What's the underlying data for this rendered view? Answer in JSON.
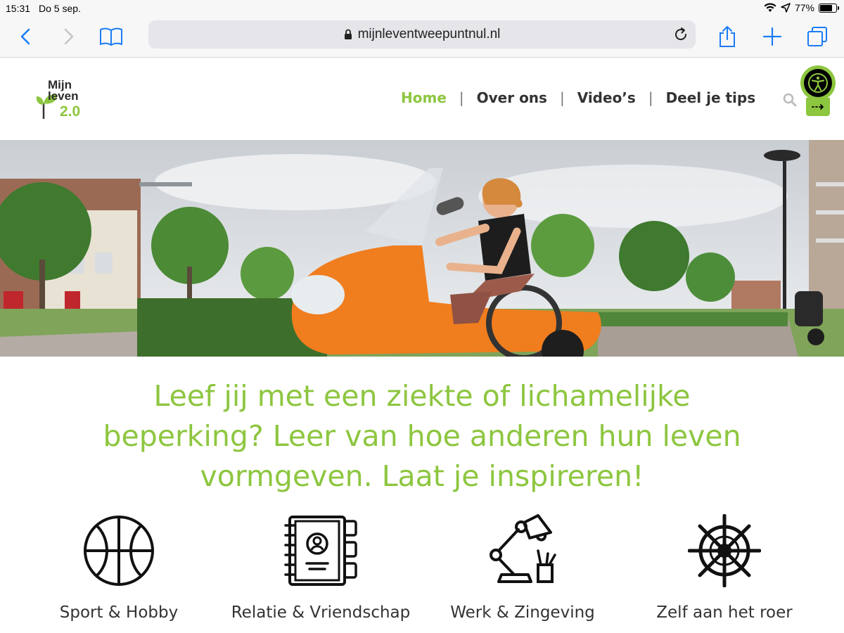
{
  "status_bar": {
    "time": "15:31",
    "date": "Do 5 sep.",
    "battery": "77%",
    "battery_level": 0.77
  },
  "browser": {
    "url": "mijnleventweepuntnul.nl"
  },
  "logo": {
    "line1": "Mijn",
    "line2": "leven",
    "line3": "2.0"
  },
  "nav": {
    "items": [
      {
        "label": "Home"
      },
      {
        "label": "Over ons"
      },
      {
        "label": "Video’s"
      },
      {
        "label": "Deel je tips"
      }
    ],
    "separator": "|"
  },
  "colors": {
    "brand_green": "#8dc63f",
    "text_dark": "#333333",
    "ios_blue": "#1a7cf5"
  },
  "hero": {
    "subject": "woman on orange scooter",
    "image_text": ""
  },
  "headline": "Leef jij met een ziekte of lichamelijke beperking? Leer van hoe anderen hun leven vormgeven. Laat je inspireren!",
  "categories": [
    {
      "label": "Sport & Hobby",
      "icon": "basketball-icon"
    },
    {
      "label": "Relatie & Vriendschap",
      "icon": "address-book-icon"
    },
    {
      "label": "Werk & Zingeving",
      "icon": "desk-lamp-icon"
    },
    {
      "label": "Zelf aan het roer",
      "icon": "ship-wheel-icon"
    }
  ]
}
